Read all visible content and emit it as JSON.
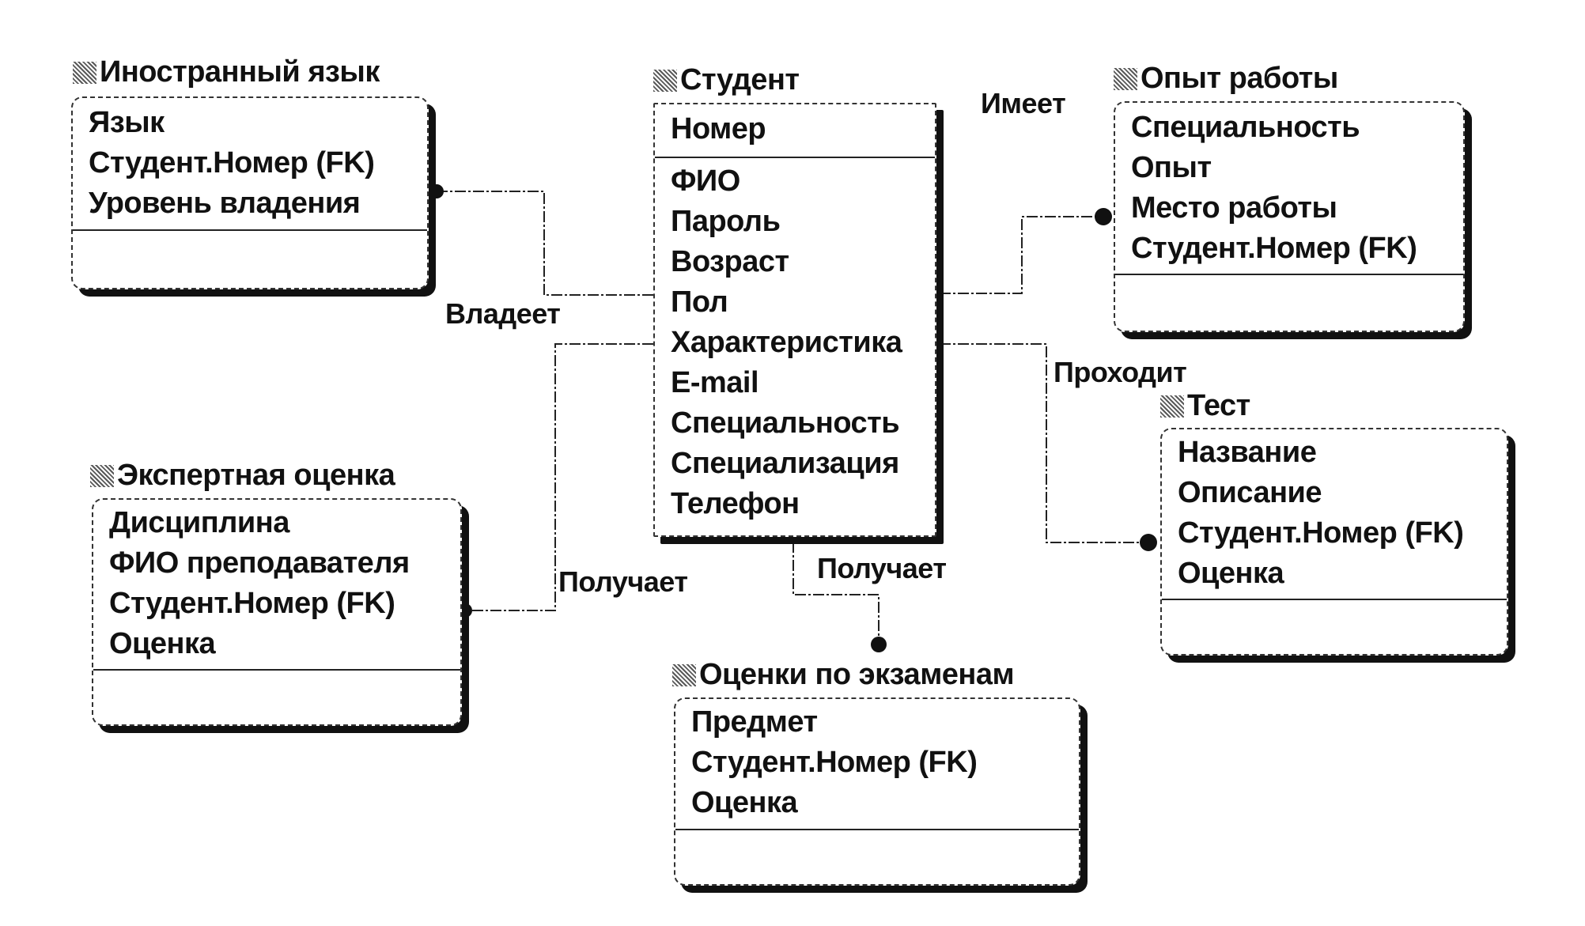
{
  "entities": {
    "foreign_language": {
      "title": "Иностранный язык",
      "key_attrs": [
        "Язык",
        "Студент.Номер (FK)",
        "Уровень владения"
      ],
      "non_key_attrs": []
    },
    "student": {
      "title": "Студент",
      "key_attrs": [
        "Номер"
      ],
      "non_key_attrs": [
        "ФИО",
        "Пароль",
        "Возраст",
        "Пол",
        "Характеристика",
        "E-mail",
        "Специальность",
        "Специализация",
        "Телефон"
      ]
    },
    "work_experience": {
      "title": "Опыт работы",
      "key_attrs": [
        "Специальность",
        "Опыт",
        "Место работы",
        "Студент.Номер (FK)"
      ],
      "non_key_attrs": []
    },
    "test": {
      "title": "Тест",
      "key_attrs": [
        "Название",
        "Описание",
        "Студент.Номер (FK)",
        "Оценка"
      ],
      "non_key_attrs": []
    },
    "expert_assessment": {
      "title": "Экспертная оценка",
      "key_attrs": [
        "Дисциплина",
        "ФИО преподавателя",
        "Студент.Номер (FK)",
        "Оценка"
      ],
      "non_key_attrs": []
    },
    "exam_grades": {
      "title": "Оценки по экзаменам",
      "key_attrs": [
        "Предмет",
        "Студент.Номер (FK)",
        "Оценка"
      ],
      "non_key_attrs": []
    }
  },
  "relationships": [
    {
      "label": "Владеет",
      "from": "Студент",
      "to": "Иностранный язык"
    },
    {
      "label": "Имеет",
      "from": "Студент",
      "to": "Опыт работы"
    },
    {
      "label": "Проходит",
      "from": "Студент",
      "to": "Тест"
    },
    {
      "label": "Получает",
      "from": "Студент",
      "to": "Экспертная оценка"
    },
    {
      "label": "Получает",
      "from": "Студент",
      "to": "Оценки по экзаменам"
    }
  ]
}
